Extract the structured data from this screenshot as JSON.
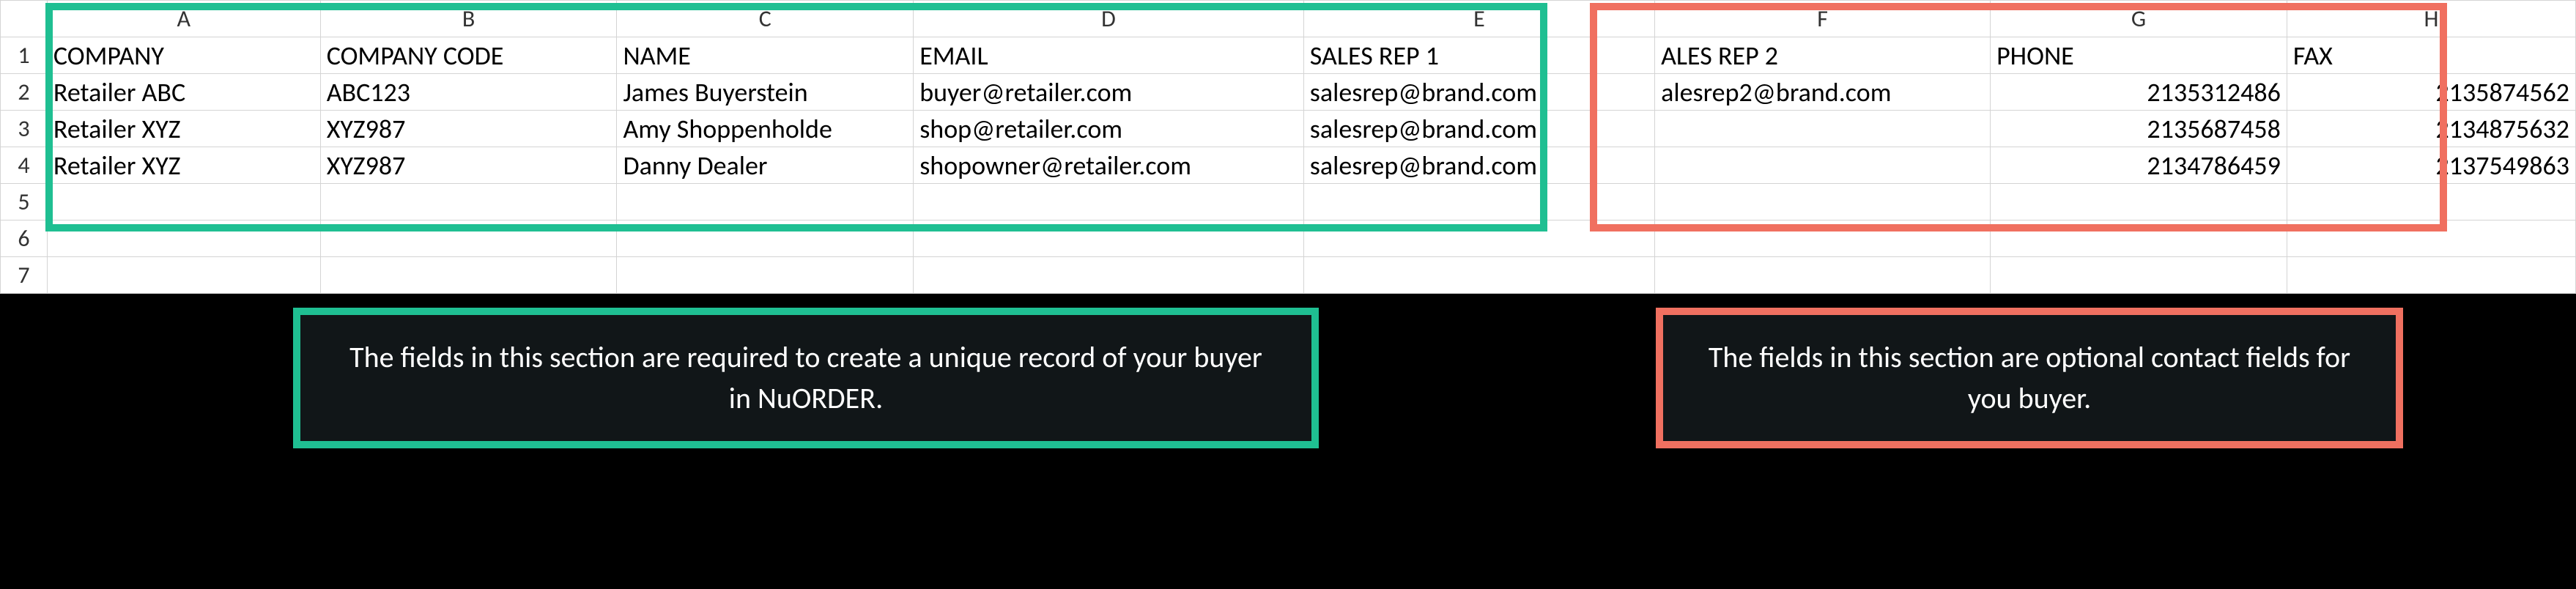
{
  "columns": [
    "A",
    "B",
    "C",
    "D",
    "E",
    "F",
    "G",
    "H"
  ],
  "headers": {
    "A": "COMPANY",
    "B": "COMPANY CODE",
    "C": "NAME",
    "D": "EMAIL",
    "E": "SALES REP 1",
    "F": "ALES REP 2",
    "G": "PHONE",
    "H": "FAX"
  },
  "rows": [
    {
      "A": "Retailer ABC",
      "B": "ABC123",
      "C": "James Buyerstein",
      "D": "buyer@retailer.com",
      "E": "salesrep@brand.com",
      "F": "alesrep2@brand.com",
      "G": "2135312486",
      "H": "2135874562"
    },
    {
      "A": "Retailer XYZ",
      "B": "XYZ987",
      "C": "Amy Shoppenholde",
      "D": "shop@retailer.com",
      "E": "salesrep@brand.com",
      "F": "",
      "G": "2135687458",
      "H": "2134875632"
    },
    {
      "A": "Retailer XYZ",
      "B": "XYZ987",
      "C": "Danny Dealer",
      "D": "shopowner@retailer.com",
      "E": "salesrep@brand.com",
      "F": "",
      "G": "2134786459",
      "H": "2137549863"
    }
  ],
  "callouts": {
    "green": "The fields in this section are required to create a unique record of your buyer in NuORDER.",
    "red": "The fields in this section are optional contact fields for you buyer."
  }
}
